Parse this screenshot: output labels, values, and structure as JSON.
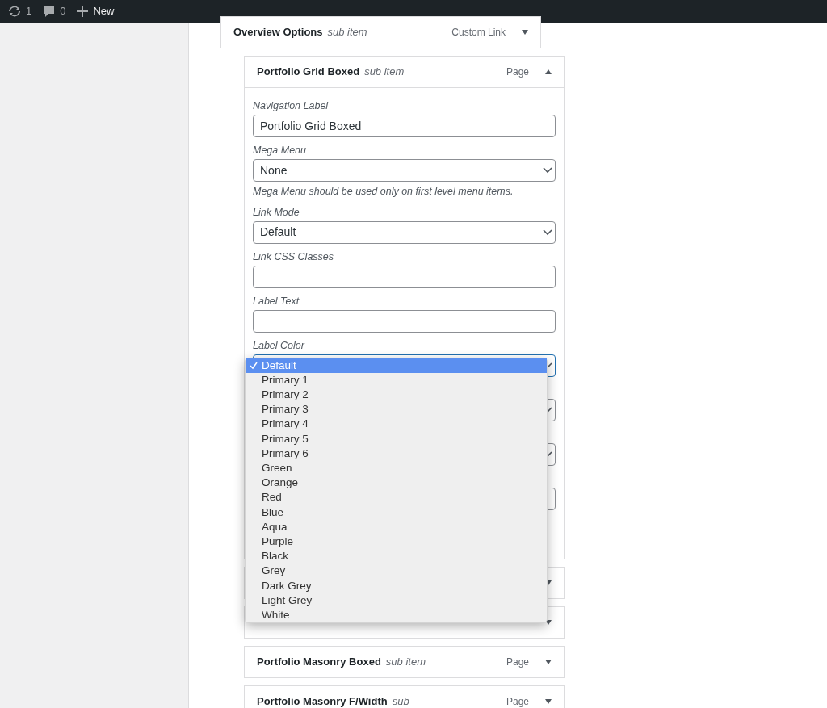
{
  "admin_bar": {
    "items": [
      {
        "kind": "updates",
        "label": "1"
      },
      {
        "kind": "comments",
        "label": "0"
      },
      {
        "kind": "new",
        "label": "New"
      }
    ]
  },
  "menu_items": [
    {
      "title": "Overview Options",
      "tag": "sub item",
      "type": "Custom Link",
      "expanded": false,
      "children": [
        {
          "title": "Portfolio Grid Boxed",
          "tag": "sub item",
          "type": "Page",
          "expanded": true,
          "fields": [
            {
              "kind": "text",
              "label": "Navigation Label",
              "value": "Portfolio Grid Boxed"
            },
            {
              "kind": "select",
              "label": "Mega Menu",
              "value": "None",
              "hint": "Mega Menu should be used only on first level menu items."
            },
            {
              "kind": "select",
              "label": "Link Mode",
              "value": "Default"
            },
            {
              "kind": "text",
              "label": "Link CSS Classes"
            },
            {
              "kind": "text",
              "label": "Label Text"
            },
            {
              "kind": "select",
              "label": "Label Color",
              "open": true,
              "options": [
                {
                  "label": "Default",
                  "selected": true
                },
                {
                  "label": "Primary 1",
                  "selected": false
                },
                {
                  "label": "Primary 2",
                  "selected": false
                },
                {
                  "label": "Primary 3",
                  "selected": false
                },
                {
                  "label": "Primary 4",
                  "selected": false
                },
                {
                  "label": "Primary 5",
                  "selected": false
                },
                {
                  "label": "Primary 6",
                  "selected": false
                },
                {
                  "label": "Green",
                  "selected": false
                },
                {
                  "label": "Orange",
                  "selected": false
                },
                {
                  "label": "Red",
                  "selected": false
                },
                {
                  "label": "Blue",
                  "selected": false
                },
                {
                  "label": "Aqua",
                  "selected": false
                },
                {
                  "label": "Purple",
                  "selected": false
                },
                {
                  "label": "Black",
                  "selected": false
                },
                {
                  "label": "Grey",
                  "selected": false
                },
                {
                  "label": "Dark Grey",
                  "selected": false
                },
                {
                  "label": "Light Grey",
                  "selected": false
                },
                {
                  "label": "White",
                  "selected": false
                }
              ]
            },
            {
              "kind": "select"
            },
            {
              "kind": "select"
            },
            {
              "kind": "text"
            }
          ]
        },
        {
          "expanded": false
        },
        {
          "expanded": false
        },
        {
          "title": "Portfolio Masonry Boxed",
          "tag": "sub item",
          "type": "Page",
          "expanded": false
        },
        {
          "title": "Portfolio Masonry F/Width",
          "tag": "sub",
          "type": "Page",
          "expanded": false
        }
      ]
    }
  ]
}
